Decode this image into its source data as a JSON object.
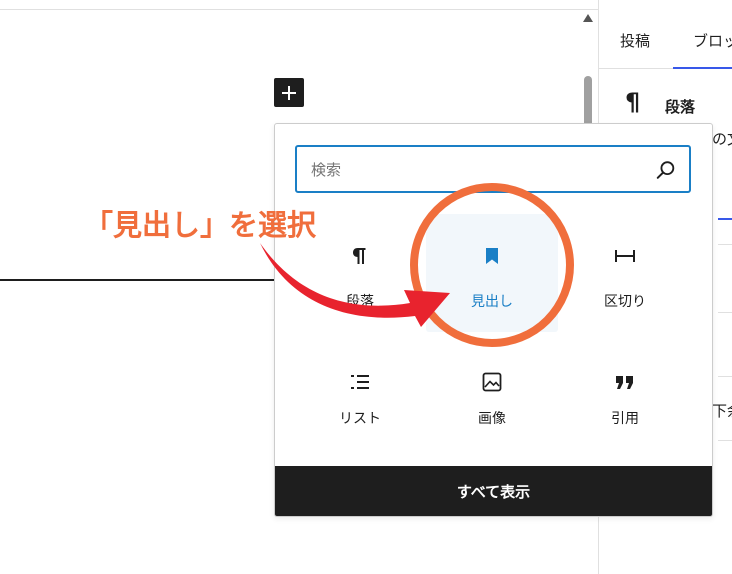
{
  "sidebar": {
    "tabs": [
      {
        "label": "投稿"
      },
      {
        "label": "ブロック"
      }
    ],
    "block_title": "段落",
    "description_fragment": "の文",
    "bottom_fragment": "下余"
  },
  "inserter": {
    "search_placeholder": "検索",
    "blocks": [
      {
        "label": "段落",
        "icon": "paragraph-icon",
        "selected": false
      },
      {
        "label": "見出し",
        "icon": "bookmark-icon",
        "selected": true
      },
      {
        "label": "区切り",
        "icon": "separator-icon",
        "selected": false
      },
      {
        "label": "リスト",
        "icon": "list-icon",
        "selected": false
      },
      {
        "label": "画像",
        "icon": "image-icon",
        "selected": false
      },
      {
        "label": "引用",
        "icon": "quote-icon",
        "selected": false
      }
    ],
    "show_all_label": "すべて表示"
  },
  "annotation": {
    "text": "「見出し」を選択",
    "color": "#f06e3c"
  },
  "colors": {
    "accent": "#1a7fc6",
    "tab_accent": "#3858e9",
    "dark": "#1e1e1e",
    "arrow": "#e8232e"
  }
}
